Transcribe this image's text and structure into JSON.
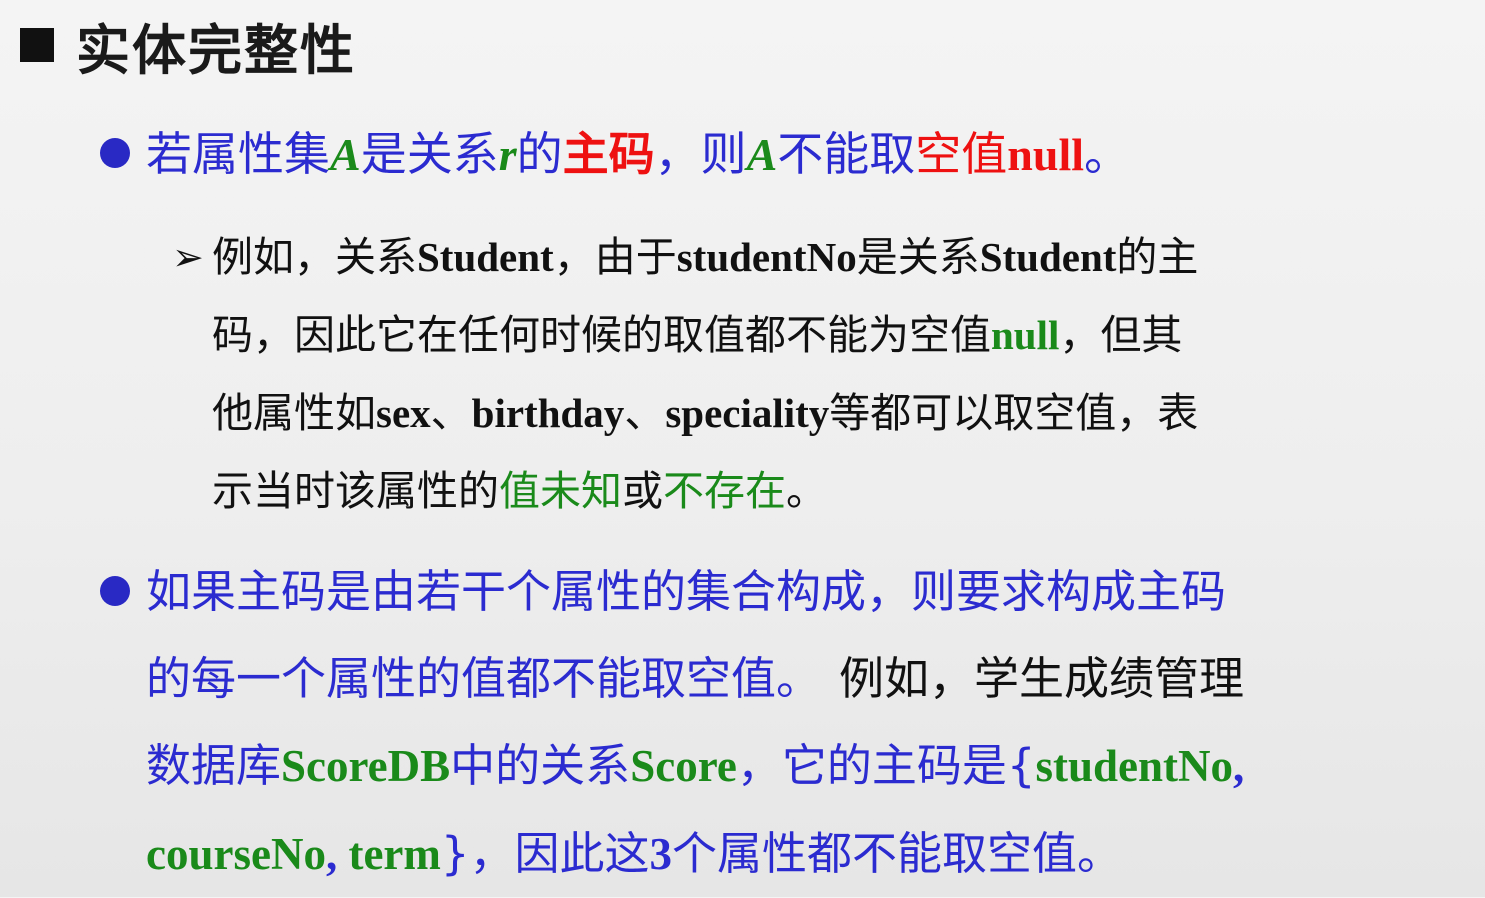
{
  "heading": {
    "bullet_icon": "black-square-icon",
    "text": "实体完整性"
  },
  "bullet1": {
    "icon": "blue-round-bullet-icon",
    "parts": [
      "若属性集",
      "A",
      "是关系",
      "r",
      "的",
      "主码",
      "，则",
      "A",
      "不能取",
      "空值",
      "null",
      "。"
    ]
  },
  "sub_item": {
    "icon": "arrow-bullet-icon",
    "arrow": "➢",
    "lines": [
      [
        "例如，关系",
        "Student",
        "，由于",
        "studentNo",
        "是关系",
        "Student",
        "的主"
      ],
      [
        "码，因此它在任何时候的取值都不能为空值",
        "null",
        "，但其"
      ],
      [
        "他属性如",
        "sex",
        "、",
        "birthday",
        "、",
        "speciality",
        "等都可以取空值，表"
      ],
      [
        "示当时该属性的",
        "值未知",
        "或",
        "不存在",
        "。"
      ]
    ]
  },
  "bullet2": {
    "icon": "blue-round-bullet-icon",
    "lines": [
      [
        "如果主码是由若干个属性的集合构成，则要求构成主码"
      ],
      [
        "的每一个属性的值都不能取空值。",
        "例如，学生成绩管理"
      ],
      [
        "数据库",
        "ScoreDB",
        "中的关系",
        "Score",
        "，它的主码是{",
        "studentNo",
        ","
      ],
      [
        "courseNo",
        ", ",
        "term",
        "}，因此这",
        "3",
        "个属性都不能取空值。"
      ]
    ]
  },
  "colors": {
    "blue": "#2b2bd0",
    "red": "#ee1111",
    "green": "#1a8a1a",
    "black": "#111111"
  }
}
